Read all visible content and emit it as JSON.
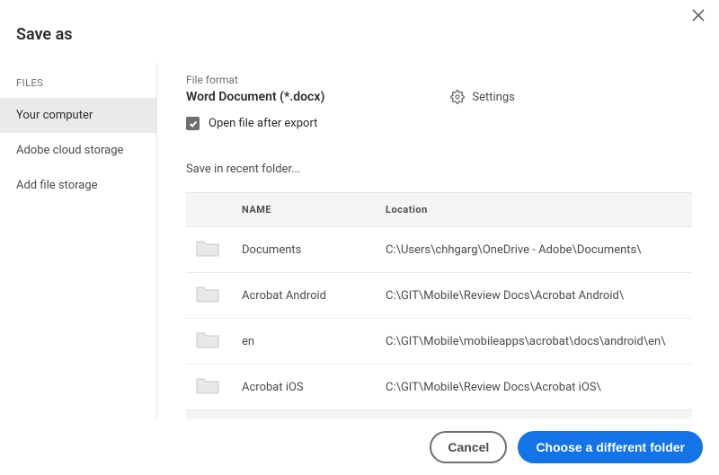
{
  "dialog": {
    "title": "Save as"
  },
  "sidebar": {
    "heading": "FILES",
    "items": [
      {
        "label": "Your computer",
        "active": true
      },
      {
        "label": "Adobe cloud storage",
        "active": false
      },
      {
        "label": "Add file storage",
        "active": false
      }
    ]
  },
  "content": {
    "file_format_heading": "File format",
    "file_format_value": "Word Document (*.docx)",
    "settings_label": "Settings",
    "open_after_export_label": "Open file after export",
    "open_after_export_checked": true,
    "recent_heading": "Save in recent folder...",
    "columns": {
      "name": "NAME",
      "location": "Location"
    },
    "rows": [
      {
        "name": "Documents",
        "location": "C:\\Users\\chhgarg\\OneDrive - Adobe\\Documents\\"
      },
      {
        "name": "Acrobat Android",
        "location": "C:\\GIT\\Mobile\\Review Docs\\Acrobat Android\\"
      },
      {
        "name": "en",
        "location": "C:\\GIT\\Mobile\\mobileapps\\acrobat\\docs\\android\\en\\"
      },
      {
        "name": "Acrobat iOS",
        "location": "C:\\GIT\\Mobile\\Review Docs\\Acrobat iOS\\"
      }
    ]
  },
  "footer": {
    "cancel": "Cancel",
    "choose": "Choose a different folder"
  }
}
